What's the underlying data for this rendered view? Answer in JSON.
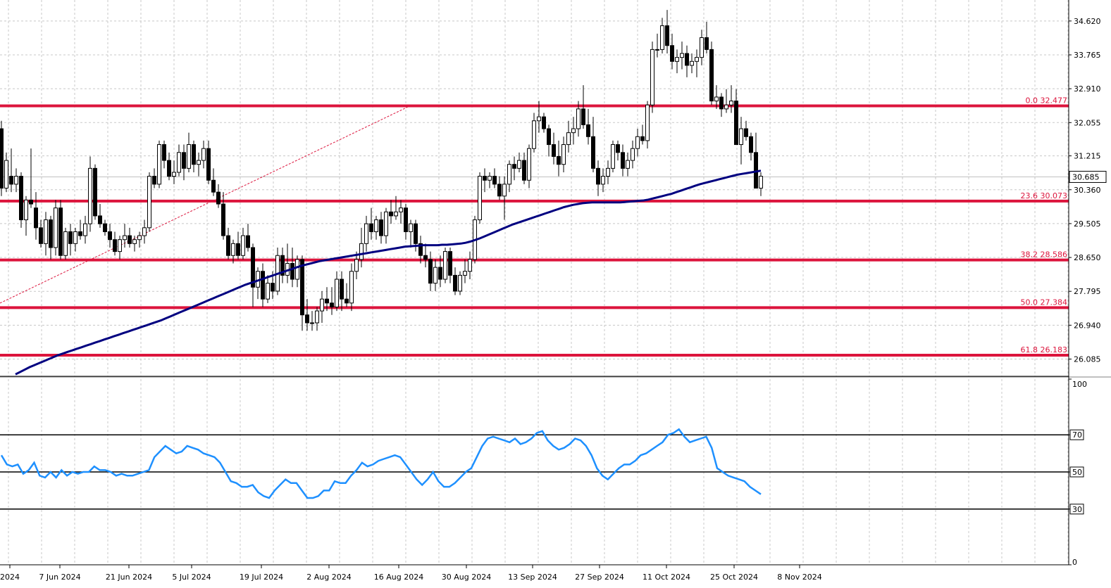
{
  "chart_data": {
    "type": "candlestick",
    "price_axis": {
      "min": 25.65,
      "max": 35.15,
      "ticks": [
        "34.620",
        "33.765",
        "32.910",
        "32.055",
        "31.215",
        "30.360",
        "29.505",
        "28.650",
        "27.795",
        "26.940",
        "26.085"
      ],
      "current_price": "30.685"
    },
    "time_axis": {
      "labels": [
        "2024",
        "7 Jun 2024",
        "21 Jun 2024",
        "5 Jul 2024",
        "19 Jul 2024",
        "2 Aug 2024",
        "16 Aug 2024",
        "30 Aug 2024",
        "13 Sep 2024",
        "27 Sep 2024",
        "11 Oct 2024",
        "25 Oct 2024",
        "8 Nov 2024"
      ]
    },
    "fib_levels": [
      {
        "label": "0.0 32.477",
        "value": 32.477
      },
      {
        "label": "23.6 30.073",
        "value": 30.073
      },
      {
        "label": "38.2 28.586",
        "value": 28.586
      },
      {
        "label": "50.0 27.384",
        "value": 27.384
      },
      {
        "label": "61.8 26.183",
        "value": 26.183
      }
    ],
    "candles": [
      [
        31.9,
        32.1,
        30.2,
        30.4
      ],
      [
        30.4,
        31.3,
        30.3,
        31.1
      ],
      [
        30.7,
        31.4,
        30.3,
        30.5
      ],
      [
        30.5,
        30.9,
        30.3,
        30.7
      ],
      [
        30.7,
        30.8,
        29.4,
        29.6
      ],
      [
        29.6,
        30.2,
        29.2,
        30.1
      ],
      [
        30.1,
        31.4,
        29.9,
        30.0
      ],
      [
        29.9,
        30.3,
        29.1,
        29.4
      ],
      [
        29.4,
        29.6,
        28.9,
        29.0
      ],
      [
        29.0,
        29.8,
        28.7,
        29.6
      ],
      [
        29.6,
        29.7,
        28.6,
        28.9
      ],
      [
        28.9,
        30.1,
        28.7,
        29.9
      ],
      [
        29.9,
        30.1,
        28.6,
        28.7
      ],
      [
        28.7,
        29.4,
        28.6,
        29.3
      ],
      [
        29.3,
        29.5,
        28.7,
        29.0
      ],
      [
        29.0,
        29.4,
        28.8,
        29.3
      ],
      [
        29.3,
        29.6,
        29.1,
        29.2
      ],
      [
        29.2,
        29.7,
        29.0,
        29.5
      ],
      [
        29.5,
        31.2,
        29.3,
        30.9
      ],
      [
        30.9,
        31.0,
        29.6,
        29.7
      ],
      [
        29.7,
        30.0,
        29.4,
        29.5
      ],
      [
        29.5,
        29.6,
        29.2,
        29.3
      ],
      [
        29.3,
        29.5,
        28.9,
        29.1
      ],
      [
        29.1,
        29.3,
        28.7,
        28.8
      ],
      [
        28.8,
        29.2,
        28.6,
        29.1
      ],
      [
        29.1,
        29.5,
        28.9,
        29.2
      ],
      [
        29.2,
        29.4,
        28.9,
        29.0
      ],
      [
        29.0,
        29.2,
        28.8,
        29.1
      ],
      [
        29.1,
        29.3,
        28.9,
        29.2
      ],
      [
        29.2,
        29.6,
        29.0,
        29.4
      ],
      [
        29.4,
        30.8,
        29.3,
        30.7
      ],
      [
        30.7,
        30.9,
        30.4,
        30.5
      ],
      [
        30.5,
        31.6,
        30.4,
        31.5
      ],
      [
        31.5,
        31.6,
        30.9,
        31.1
      ],
      [
        31.1,
        31.3,
        30.6,
        30.7
      ],
      [
        30.7,
        31.1,
        30.5,
        30.8
      ],
      [
        30.8,
        31.5,
        30.7,
        31.3
      ],
      [
        31.3,
        31.5,
        30.6,
        30.9
      ],
      [
        30.9,
        31.8,
        30.8,
        31.5
      ],
      [
        31.5,
        31.6,
        30.8,
        31.0
      ],
      [
        31.0,
        31.3,
        30.7,
        31.1
      ],
      [
        31.1,
        31.6,
        30.9,
        31.4
      ],
      [
        31.4,
        31.6,
        30.5,
        30.6
      ],
      [
        30.6,
        30.9,
        30.2,
        30.3
      ],
      [
        30.3,
        30.5,
        29.9,
        30.0
      ],
      [
        30.0,
        30.3,
        29.1,
        29.2
      ],
      [
        29.2,
        29.4,
        28.6,
        28.7
      ],
      [
        28.7,
        29.1,
        28.5,
        29.0
      ],
      [
        29.0,
        29.3,
        28.6,
        28.7
      ],
      [
        28.7,
        29.4,
        28.6,
        29.2
      ],
      [
        29.2,
        29.5,
        28.8,
        28.9
      ],
      [
        28.9,
        29.0,
        27.4,
        27.9
      ],
      [
        27.9,
        28.4,
        27.6,
        28.3
      ],
      [
        28.3,
        28.5,
        27.4,
        27.6
      ],
      [
        27.6,
        28.2,
        27.5,
        28.0
      ],
      [
        28.0,
        28.3,
        27.6,
        27.8
      ],
      [
        27.8,
        28.9,
        27.7,
        28.7
      ],
      [
        28.7,
        28.9,
        28.0,
        28.2
      ],
      [
        28.2,
        29.0,
        28.0,
        28.5
      ],
      [
        28.5,
        28.9,
        27.9,
        28.1
      ],
      [
        28.1,
        28.7,
        27.9,
        28.6
      ],
      [
        28.6,
        28.7,
        26.8,
        27.2
      ],
      [
        27.2,
        27.6,
        26.8,
        27.0
      ],
      [
        27.0,
        27.3,
        26.8,
        27.0
      ],
      [
        27.0,
        27.4,
        26.8,
        27.3
      ],
      [
        27.3,
        27.8,
        27.0,
        27.6
      ],
      [
        27.6,
        27.9,
        27.3,
        27.5
      ],
      [
        27.5,
        27.9,
        27.2,
        27.4
      ],
      [
        27.4,
        28.3,
        27.3,
        28.1
      ],
      [
        28.1,
        28.3,
        27.3,
        27.6
      ],
      [
        27.6,
        28.0,
        27.4,
        27.5
      ],
      [
        27.5,
        28.5,
        27.3,
        28.3
      ],
      [
        28.3,
        28.8,
        28.1,
        28.6
      ],
      [
        28.6,
        29.4,
        28.4,
        29.0
      ],
      [
        29.0,
        29.7,
        28.8,
        29.5
      ],
      [
        29.5,
        29.9,
        29.1,
        29.3
      ],
      [
        29.3,
        29.7,
        29.1,
        29.6
      ],
      [
        29.6,
        29.8,
        29.0,
        29.2
      ],
      [
        29.2,
        29.9,
        29.0,
        29.8
      ],
      [
        29.8,
        30.1,
        29.5,
        29.7
      ],
      [
        29.7,
        30.2,
        29.6,
        29.8
      ],
      [
        29.8,
        30.1,
        29.5,
        29.9
      ],
      [
        29.9,
        30.0,
        29.1,
        29.3
      ],
      [
        29.3,
        29.6,
        28.9,
        29.5
      ],
      [
        29.5,
        29.6,
        28.8,
        29.0
      ],
      [
        29.0,
        29.2,
        28.5,
        28.7
      ],
      [
        28.7,
        29.0,
        28.4,
        28.6
      ],
      [
        28.6,
        28.8,
        27.8,
        28.0
      ],
      [
        28.0,
        28.6,
        27.8,
        28.4
      ],
      [
        28.4,
        28.7,
        27.9,
        28.1
      ],
      [
        28.1,
        28.9,
        28.0,
        28.8
      ],
      [
        28.8,
        28.9,
        28.0,
        28.2
      ],
      [
        28.2,
        28.4,
        27.7,
        27.8
      ],
      [
        27.8,
        28.3,
        27.7,
        28.2
      ],
      [
        28.2,
        28.6,
        28.0,
        28.3
      ],
      [
        28.3,
        28.8,
        28.1,
        28.6
      ],
      [
        28.6,
        29.7,
        28.5,
        29.6
      ],
      [
        29.6,
        30.8,
        29.5,
        30.7
      ],
      [
        30.7,
        30.9,
        30.3,
        30.6
      ],
      [
        30.6,
        30.8,
        30.4,
        30.7
      ],
      [
        30.7,
        30.9,
        30.4,
        30.5
      ],
      [
        30.5,
        30.7,
        30.1,
        30.2
      ],
      [
        30.2,
        30.7,
        29.6,
        30.5
      ],
      [
        30.5,
        31.1,
        30.3,
        31.0
      ],
      [
        31.0,
        31.2,
        30.6,
        30.9
      ],
      [
        30.9,
        31.3,
        30.8,
        31.1
      ],
      [
        31.1,
        31.3,
        30.5,
        30.6
      ],
      [
        30.6,
        31.5,
        30.4,
        31.4
      ],
      [
        31.4,
        32.3,
        31.3,
        32.1
      ],
      [
        32.1,
        32.6,
        31.8,
        32.2
      ],
      [
        32.2,
        32.3,
        31.8,
        31.9
      ],
      [
        31.9,
        32.0,
        31.2,
        31.5
      ],
      [
        31.5,
        31.8,
        31.0,
        31.2
      ],
      [
        31.2,
        31.6,
        30.7,
        31.0
      ],
      [
        31.0,
        31.7,
        30.8,
        31.5
      ],
      [
        31.5,
        32.1,
        31.3,
        31.8
      ],
      [
        31.8,
        32.2,
        31.5,
        31.9
      ],
      [
        31.9,
        32.6,
        31.7,
        32.4
      ],
      [
        32.4,
        33.0,
        31.9,
        32.0
      ],
      [
        32.0,
        32.4,
        31.5,
        31.7
      ],
      [
        31.7,
        32.2,
        30.8,
        30.9
      ],
      [
        30.9,
        31.1,
        30.2,
        30.5
      ],
      [
        30.5,
        30.9,
        30.3,
        30.7
      ],
      [
        30.7,
        31.1,
        30.5,
        30.9
      ],
      [
        30.9,
        31.6,
        30.8,
        31.5
      ],
      [
        31.5,
        31.6,
        31.1,
        31.3
      ],
      [
        31.3,
        31.5,
        30.7,
        30.9
      ],
      [
        30.9,
        31.3,
        30.7,
        31.1
      ],
      [
        31.1,
        31.6,
        30.9,
        31.4
      ],
      [
        31.4,
        31.9,
        31.2,
        31.7
      ],
      [
        31.7,
        32.0,
        31.5,
        31.6
      ],
      [
        31.6,
        32.6,
        31.4,
        32.5
      ],
      [
        32.5,
        34.1,
        32.3,
        33.9
      ],
      [
        33.9,
        34.3,
        33.7,
        33.9
      ],
      [
        33.9,
        34.7,
        33.8,
        34.5
      ],
      [
        34.5,
        34.9,
        33.8,
        34.0
      ],
      [
        34.0,
        34.3,
        33.4,
        33.6
      ],
      [
        33.6,
        33.9,
        33.3,
        33.7
      ],
      [
        33.7,
        34.1,
        33.4,
        33.8
      ],
      [
        33.8,
        34.0,
        33.2,
        33.5
      ],
      [
        33.5,
        33.8,
        33.3,
        33.6
      ],
      [
        33.6,
        33.9,
        33.2,
        33.7
      ],
      [
        33.7,
        34.4,
        33.5,
        34.2
      ],
      [
        34.2,
        34.6,
        33.8,
        33.9
      ],
      [
        33.9,
        34.1,
        32.5,
        32.6
      ],
      [
        32.6,
        33.0,
        32.4,
        32.7
      ],
      [
        32.7,
        32.8,
        32.2,
        32.4
      ],
      [
        32.4,
        32.9,
        32.3,
        32.5
      ],
      [
        32.5,
        33.0,
        32.3,
        32.6
      ],
      [
        32.6,
        32.9,
        31.5,
        31.5
      ],
      [
        31.5,
        32.2,
        31.0,
        31.9
      ],
      [
        31.9,
        32.1,
        31.6,
        31.7
      ],
      [
        31.7,
        31.8,
        31.1,
        31.3
      ],
      [
        31.3,
        31.8,
        30.9,
        30.4
      ],
      [
        30.4,
        30.8,
        30.2,
        30.7
      ]
    ],
    "ma_values": [
      25.7,
      25.76,
      25.82,
      25.88,
      25.93,
      25.98,
      26.03,
      26.08,
      26.13,
      26.18,
      26.22,
      26.26,
      26.3,
      26.34,
      26.38,
      26.42,
      26.46,
      26.5,
      26.54,
      26.58,
      26.62,
      26.66,
      26.7,
      26.74,
      26.78,
      26.82,
      26.86,
      26.9,
      26.94,
      26.98,
      27.02,
      27.06,
      27.11,
      27.16,
      27.21,
      27.26,
      27.31,
      27.36,
      27.41,
      27.46,
      27.51,
      27.56,
      27.61,
      27.66,
      27.71,
      27.76,
      27.81,
      27.86,
      27.91,
      27.96,
      28.0,
      28.04,
      28.08,
      28.12,
      28.16,
      28.2,
      28.24,
      28.28,
      28.32,
      28.36,
      28.4,
      28.44,
      28.47,
      28.5,
      28.53,
      28.56,
      28.58,
      28.6,
      28.62,
      28.64,
      28.66,
      28.68,
      28.7,
      28.72,
      28.74,
      28.76,
      28.78,
      28.8,
      28.82,
      28.84,
      28.86,
      28.88,
      28.9,
      28.92,
      28.93,
      28.94,
      28.95,
      28.96,
      28.96,
      28.96,
      28.96,
      28.97,
      28.97,
      28.98,
      28.99,
      29.0,
      29.02,
      29.05,
      29.09,
      29.13,
      29.18,
      29.23,
      29.28,
      29.33,
      29.38,
      29.43,
      29.48,
      29.52,
      29.56,
      29.6,
      29.64,
      29.68,
      29.72,
      29.76,
      29.8,
      29.84,
      29.88,
      29.92,
      29.95,
      29.98,
      30.0,
      30.02,
      30.03,
      30.04,
      30.04,
      30.04,
      30.04,
      30.04,
      30.04,
      30.04,
      30.05,
      30.06,
      30.07,
      30.08,
      30.09,
      30.11,
      30.14,
      30.17,
      30.2,
      30.23,
      30.26,
      30.3,
      30.34,
      30.38,
      30.42,
      30.46,
      30.5,
      30.53,
      30.56,
      30.59,
      30.62,
      30.65,
      30.68,
      30.71,
      30.74,
      30.76,
      30.78,
      30.8,
      30.82,
      30.84
    ],
    "rsi": {
      "ticks": [
        "100",
        "70",
        "50",
        "30",
        "0"
      ],
      "levels": [
        70,
        50,
        30
      ],
      "values": [
        59,
        54,
        53,
        54,
        49,
        51,
        55,
        48,
        47,
        50,
        47,
        51,
        48,
        50,
        49,
        50,
        50,
        53,
        51,
        51,
        50,
        48,
        49,
        48,
        48,
        49,
        50,
        51,
        58,
        61,
        64,
        62,
        60,
        61,
        64,
        63,
        62,
        60,
        59,
        58,
        55,
        50,
        45,
        44,
        42,
        42,
        43,
        39,
        37,
        36,
        40,
        43,
        46,
        44,
        44,
        40,
        36,
        36,
        37,
        40,
        40,
        45,
        44,
        44,
        48,
        51,
        55,
        53,
        54,
        56,
        57,
        58,
        59,
        58,
        54,
        50,
        46,
        43,
        46,
        50,
        45,
        42,
        42,
        44,
        47,
        50,
        52,
        58,
        64,
        68,
        69,
        68,
        67,
        66,
        68,
        65,
        66,
        68,
        71,
        72,
        67,
        64,
        62,
        63,
        65,
        68,
        67,
        64,
        59,
        52,
        48,
        46,
        49,
        52,
        54,
        54,
        56,
        59,
        60,
        62,
        64,
        66,
        70,
        71,
        73,
        69,
        66,
        67,
        68,
        69,
        63,
        52,
        50,
        48,
        47,
        46,
        45,
        42,
        40,
        38
      ]
    }
  }
}
